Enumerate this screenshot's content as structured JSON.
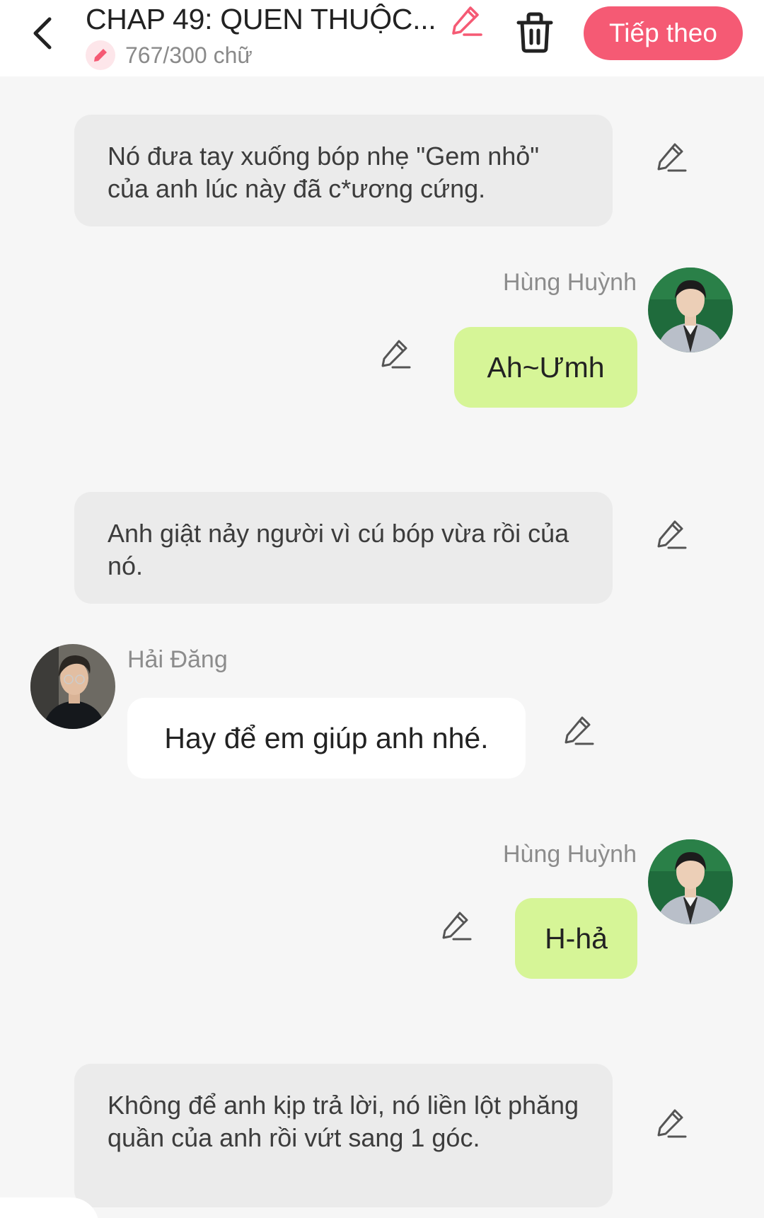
{
  "header": {
    "title": "CHAP 49: QUEN THUỘC...",
    "word_count": "767/300 chữ",
    "next_label": "Tiếp theo",
    "accent_color": "#f55a74"
  },
  "messages": {
    "narration_1": "Nó đưa tay xuống bóp nhẹ \"Gem nhỏ\" của anh lúc này đã c*ương cứng.",
    "hung_name_1": "Hùng Huỳnh",
    "hung_msg_1": "Ah~Ưmh",
    "narration_2": "Anh giật nảy người vì cú bóp vừa rồi của nó.",
    "hai_name": "Hải Đăng",
    "hai_msg": "Hay để em giúp anh nhé.",
    "hung_name_2": "Hùng Huỳnh",
    "hung_msg_2": "H-hả",
    "narration_3": "Không để anh kịp trả lời, nó liền lột phăng quần của anh rồi vứt sang 1 góc."
  },
  "icons": {
    "back": "chevron-left-icon",
    "title_edit": "pencil-icon",
    "count": "pencil-badge-icon",
    "trash": "trash-icon",
    "edit": "pencil-icon"
  }
}
